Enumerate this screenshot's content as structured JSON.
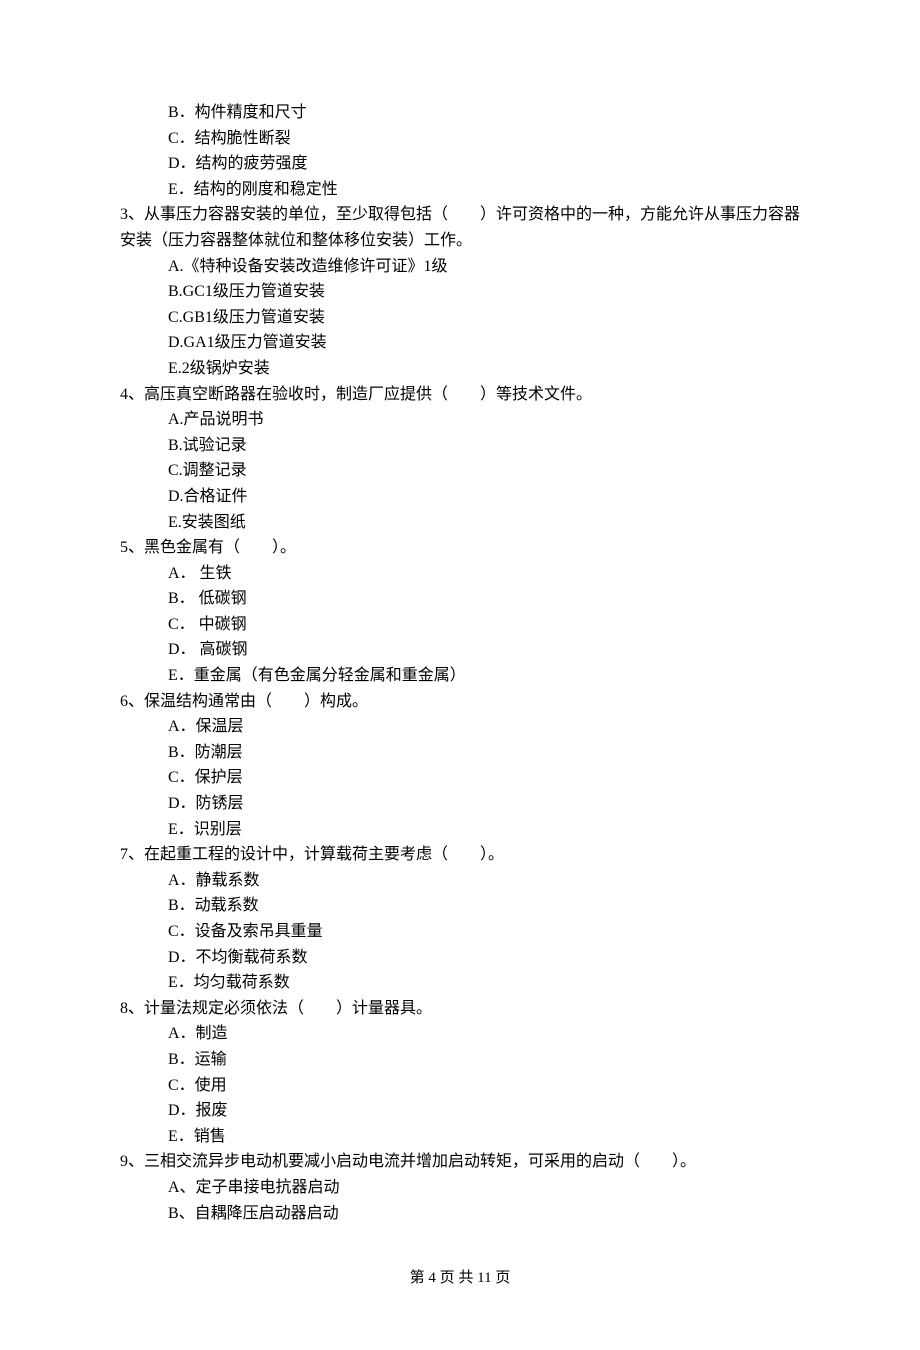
{
  "extra_options": [
    "B．构件精度和尺寸",
    "C．结构脆性断裂",
    "D．结构的疲劳强度",
    "E．结构的刚度和稳定性"
  ],
  "questions": [
    {
      "stem": "3、从事压力容器安装的单位，至少取得包括（　　）许可资格中的一种，方能允许从事压力容器安装（压力容器整体就位和整体移位安装）工作。",
      "options": [
        "A.《特种设备安装改造维修许可证》1级",
        "B.GC1级压力管道安装",
        "C.GB1级压力管道安装",
        "D.GA1级压力管道安装",
        "E.2级锅炉安装"
      ]
    },
    {
      "stem": "4、高压真空断路器在验收时，制造厂应提供（　　）等技术文件。",
      "options": [
        "A.产品说明书",
        "B.试验记录",
        "C.调整记录",
        "D.合格证件",
        "E.安装图纸"
      ]
    },
    {
      "stem": "5、黑色金属有（　　）。",
      "options": [
        "A． 生铁",
        "B． 低碳钢",
        "C． 中碳钢",
        "D． 高碳钢",
        "E．重金属（有色金属分轻金属和重金属）"
      ]
    },
    {
      "stem": "6、保温结构通常由（　　）构成。",
      "options": [
        "A．保温层",
        "B．防潮层",
        "C．保护层",
        "D．防锈层",
        "E．识别层"
      ]
    },
    {
      "stem": "7、在起重工程的设计中，计算载荷主要考虑（　　）。",
      "options": [
        "A．静载系数",
        "B．动载系数",
        "C．设备及索吊具重量",
        "D．不均衡载荷系数",
        "E．均匀载荷系数"
      ]
    },
    {
      "stem": "8、计量法规定必须依法（　　）计量器具。",
      "options": [
        "A．制造",
        "B．运输",
        "C．使用",
        "D．报废",
        "E．销售"
      ]
    },
    {
      "stem": "9、三相交流异步电动机要减小启动电流并增加启动转矩，可采用的启动（　　）。",
      "options": [
        "A、定子串接电抗器启动",
        "B、自耦降压启动器启动"
      ]
    }
  ],
  "footer": "第 4 页 共 11 页"
}
